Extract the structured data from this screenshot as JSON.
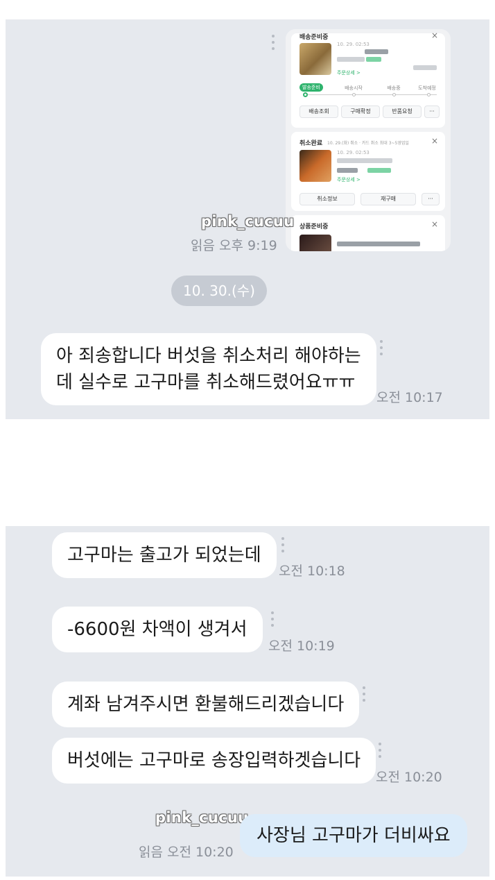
{
  "watermark": "pink_cucuu",
  "panel1": {
    "screenshot": {
      "card1": {
        "title": "배송준비중",
        "date": "10. 29. 02:53",
        "order_detail": "주문상세 >",
        "steps": [
          "발송준비",
          "배송시작",
          "배송중",
          "도착예정"
        ],
        "buttons": [
          "배송조회",
          "구매확정",
          "반품요청",
          "···"
        ]
      },
      "card2": {
        "title": "취소완료",
        "info": "10. 29.(화) 취소 · 카드 취소 최대 3~5영업일",
        "date": "10. 29. 02:53",
        "order_detail": "주문상세 >",
        "buttons": [
          "취소정보",
          "재구매",
          "···"
        ]
      },
      "card3": {
        "title": "상품준비중"
      },
      "close": "×"
    },
    "read_time": "읽음 오후 9:19",
    "date_divider": "10. 30.(수)",
    "msg1": {
      "line1": "아 죄송합니다 버섯을 취소처리 해야하는",
      "line2": "데 실수로 고구마를 취소해드렸어요ㅠㅠ",
      "time": "오전 10:17"
    }
  },
  "panel2": {
    "messages": [
      {
        "text": "고구마는 출고가 되었는데",
        "time": "오전 10:18"
      },
      {
        "text": "-6600원 차액이 생겨서",
        "time": "오전 10:19"
      },
      {
        "text": "계좌 남겨주시면 환불해드리겠습니다",
        "time": ""
      },
      {
        "text": "버섯에는 고구마로 송장입력하겟습니다",
        "time": "오전 10:20"
      }
    ],
    "reply": {
      "text": "사장님 고구마가 더비싸요",
      "time": "읽음 오전 10:20"
    }
  },
  "colors": {
    "background": "#e6e9ee",
    "incoming_bubble": "#ffffff",
    "outgoing_bubble": "#dcecfa",
    "date_pill": "#c6cbd3",
    "timestamp": "#8a8f98",
    "accent_green": "#2fb36d"
  }
}
